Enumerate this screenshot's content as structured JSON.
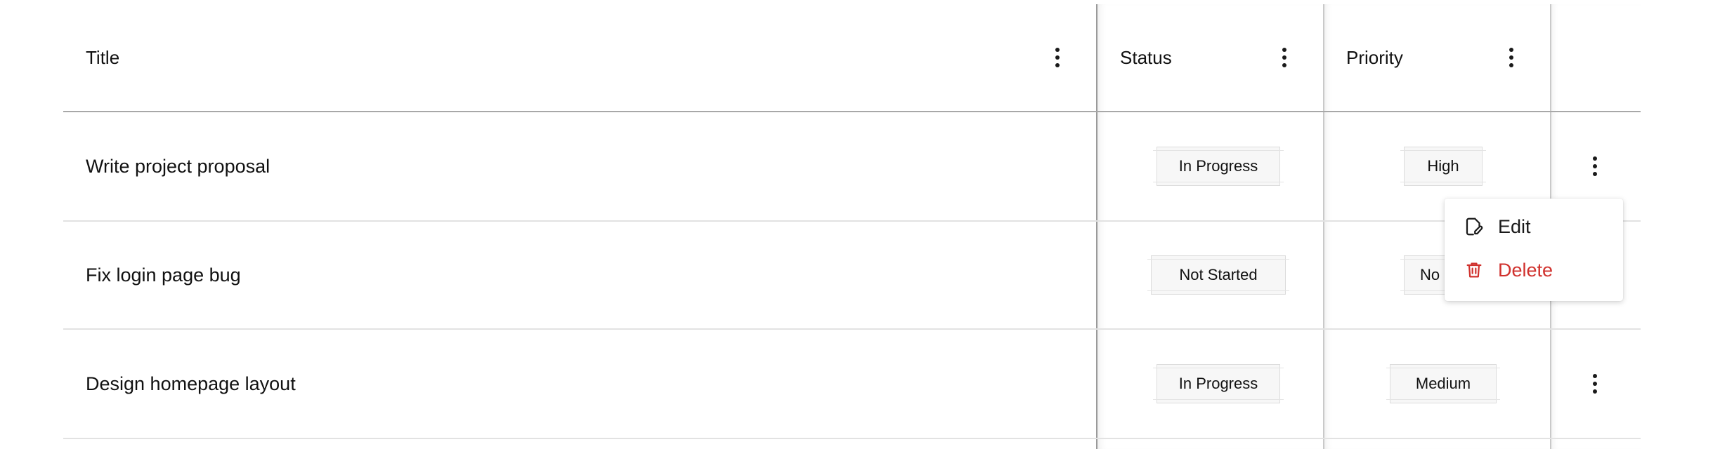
{
  "columns": {
    "title": "Title",
    "status": "Status",
    "priority": "Priority"
  },
  "rows": [
    {
      "title": "Write project proposal",
      "status": "In Progress",
      "priority": "High"
    },
    {
      "title": "Fix login page bug",
      "status": "Not Started",
      "priority": "No"
    },
    {
      "title": "Design homepage layout",
      "status": "In Progress",
      "priority": "Medium"
    }
  ],
  "row_menu": {
    "edit_label": "Edit",
    "delete_label": "Delete",
    "edit_icon": "edit-note-icon",
    "delete_icon": "trash-icon"
  },
  "colors": {
    "delete": "#d0312d",
    "header_divider": "#a8a8a8",
    "row_divider": "#e2e2e2"
  }
}
